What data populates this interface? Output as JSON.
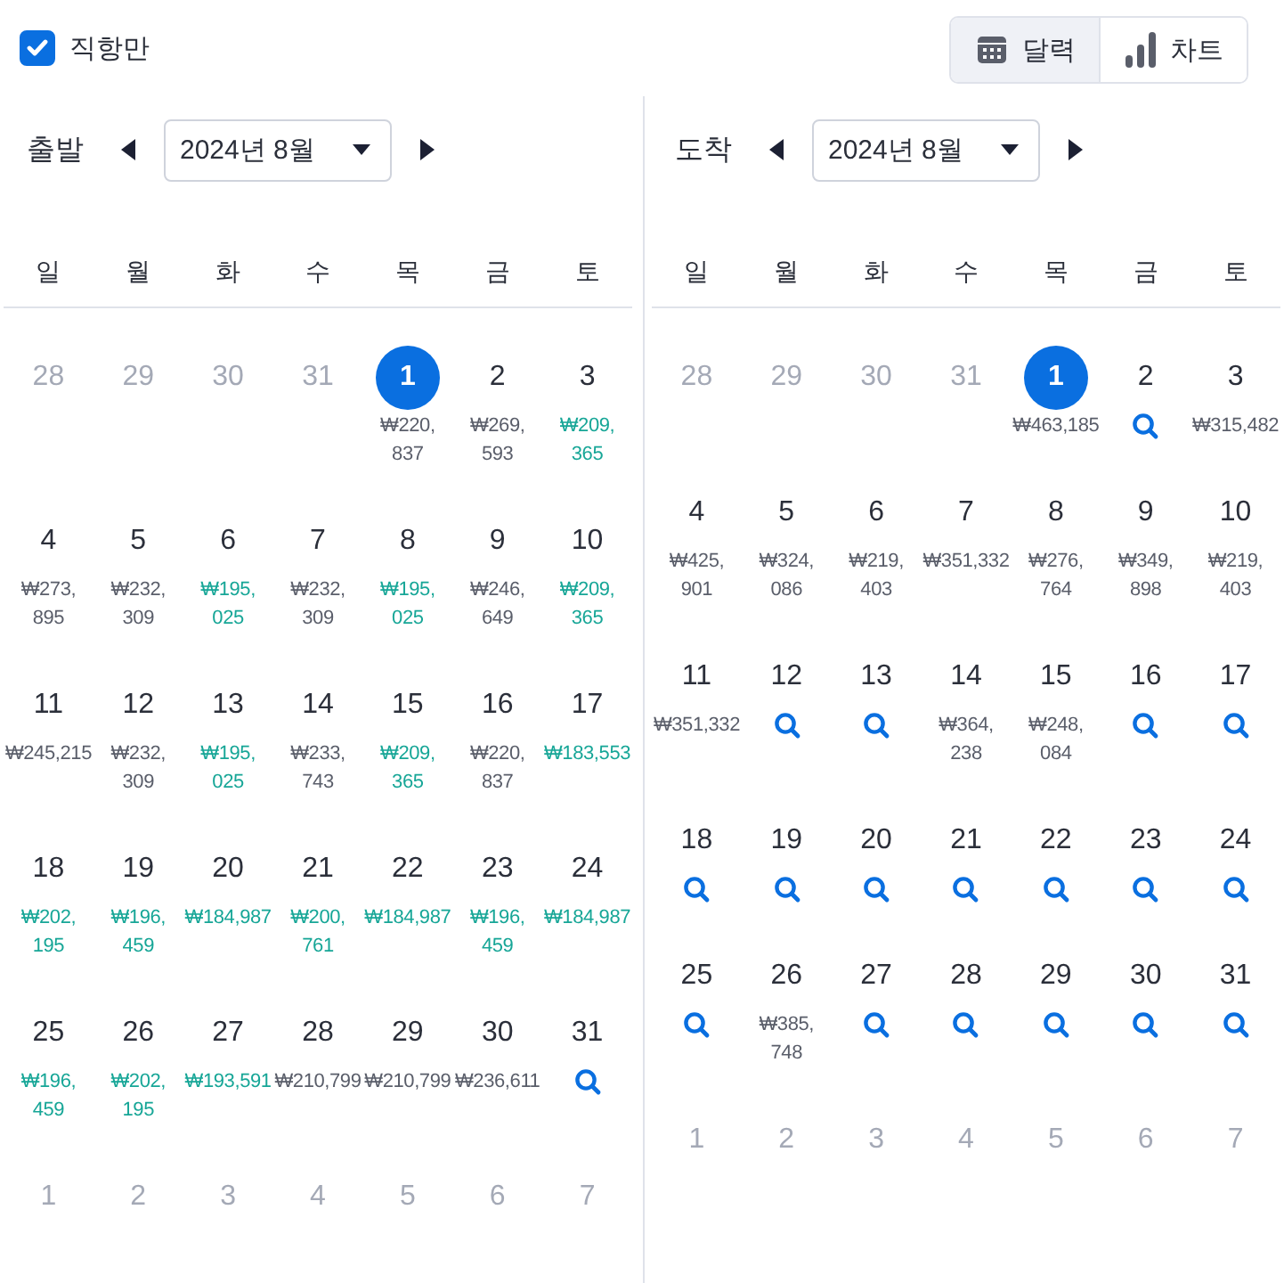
{
  "direct_only": {
    "label": "직항만",
    "checked": true
  },
  "view_toggle": [
    {
      "label": "달력",
      "kind": "calendar",
      "selected": true
    },
    {
      "label": "차트",
      "kind": "chart",
      "selected": false
    }
  ],
  "panels": [
    {
      "label": "출발",
      "month": "2024년 8월",
      "weekdays": [
        "일",
        "월",
        "화",
        "수",
        "목",
        "금",
        "토"
      ],
      "days": [
        {
          "day": "28",
          "kind": "outside",
          "selected": false
        },
        {
          "day": "29",
          "kind": "outside",
          "selected": false
        },
        {
          "day": "30",
          "kind": "outside",
          "selected": false
        },
        {
          "day": "31",
          "kind": "outside",
          "selected": false
        },
        {
          "day": "1",
          "kind": "price",
          "selected": true,
          "price": "₩220,\n837",
          "cheap": false
        },
        {
          "day": "2",
          "kind": "price",
          "selected": false,
          "price": "₩269,\n593",
          "cheap": false
        },
        {
          "day": "3",
          "kind": "price",
          "selected": false,
          "price": "₩209,\n365",
          "cheap": true
        },
        {
          "day": "4",
          "kind": "price",
          "selected": false,
          "price": "₩273,\n895",
          "cheap": false
        },
        {
          "day": "5",
          "kind": "price",
          "selected": false,
          "price": "₩232,\n309",
          "cheap": false
        },
        {
          "day": "6",
          "kind": "price",
          "selected": false,
          "price": "₩195,\n025",
          "cheap": true
        },
        {
          "day": "7",
          "kind": "price",
          "selected": false,
          "price": "₩232,\n309",
          "cheap": false
        },
        {
          "day": "8",
          "kind": "price",
          "selected": false,
          "price": "₩195,\n025",
          "cheap": true
        },
        {
          "day": "9",
          "kind": "price",
          "selected": false,
          "price": "₩246,\n649",
          "cheap": false
        },
        {
          "day": "10",
          "kind": "price",
          "selected": false,
          "price": "₩209,\n365",
          "cheap": true
        },
        {
          "day": "11",
          "kind": "price",
          "selected": false,
          "price": "₩245,215",
          "cheap": false
        },
        {
          "day": "12",
          "kind": "price",
          "selected": false,
          "price": "₩232,\n309",
          "cheap": false
        },
        {
          "day": "13",
          "kind": "price",
          "selected": false,
          "price": "₩195,\n025",
          "cheap": true
        },
        {
          "day": "14",
          "kind": "price",
          "selected": false,
          "price": "₩233,\n743",
          "cheap": false
        },
        {
          "day": "15",
          "kind": "price",
          "selected": false,
          "price": "₩209,\n365",
          "cheap": true
        },
        {
          "day": "16",
          "kind": "price",
          "selected": false,
          "price": "₩220,\n837",
          "cheap": false
        },
        {
          "day": "17",
          "kind": "price",
          "selected": false,
          "price": "₩183,553",
          "cheap": true
        },
        {
          "day": "18",
          "kind": "price",
          "selected": false,
          "price": "₩202,\n195",
          "cheap": true
        },
        {
          "day": "19",
          "kind": "price",
          "selected": false,
          "price": "₩196,\n459",
          "cheap": true
        },
        {
          "day": "20",
          "kind": "price",
          "selected": false,
          "price": "₩184,987",
          "cheap": true
        },
        {
          "day": "21",
          "kind": "price",
          "selected": false,
          "price": "₩200,\n761",
          "cheap": true
        },
        {
          "day": "22",
          "kind": "price",
          "selected": false,
          "price": "₩184,987",
          "cheap": true
        },
        {
          "day": "23",
          "kind": "price",
          "selected": false,
          "price": "₩196,\n459",
          "cheap": true
        },
        {
          "day": "24",
          "kind": "price",
          "selected": false,
          "price": "₩184,987",
          "cheap": true
        },
        {
          "day": "25",
          "kind": "price",
          "selected": false,
          "price": "₩196,\n459",
          "cheap": true
        },
        {
          "day": "26",
          "kind": "price",
          "selected": false,
          "price": "₩202,\n195",
          "cheap": true
        },
        {
          "day": "27",
          "kind": "price",
          "selected": false,
          "price": "₩193,591",
          "cheap": true
        },
        {
          "day": "28",
          "kind": "price",
          "selected": false,
          "price": "₩210,799",
          "cheap": false
        },
        {
          "day": "29",
          "kind": "price",
          "selected": false,
          "price": "₩210,799",
          "cheap": false
        },
        {
          "day": "30",
          "kind": "price",
          "selected": false,
          "price": "₩236,611",
          "cheap": false
        },
        {
          "day": "31",
          "kind": "search",
          "selected": false
        },
        {
          "day": "1",
          "kind": "outside",
          "selected": false
        },
        {
          "day": "2",
          "kind": "outside",
          "selected": false
        },
        {
          "day": "3",
          "kind": "outside",
          "selected": false
        },
        {
          "day": "4",
          "kind": "outside",
          "selected": false
        },
        {
          "day": "5",
          "kind": "outside",
          "selected": false
        },
        {
          "day": "6",
          "kind": "outside",
          "selected": false
        },
        {
          "day": "7",
          "kind": "outside",
          "selected": false
        }
      ]
    },
    {
      "label": "도착",
      "month": "2024년 8월",
      "weekdays": [
        "일",
        "월",
        "화",
        "수",
        "목",
        "금",
        "토"
      ],
      "days": [
        {
          "day": "28",
          "kind": "outside",
          "selected": false
        },
        {
          "day": "29",
          "kind": "outside",
          "selected": false
        },
        {
          "day": "30",
          "kind": "outside",
          "selected": false
        },
        {
          "day": "31",
          "kind": "outside",
          "selected": false
        },
        {
          "day": "1",
          "kind": "price",
          "selected": true,
          "price": "₩463,185",
          "cheap": false
        },
        {
          "day": "2",
          "kind": "search",
          "selected": false
        },
        {
          "day": "3",
          "kind": "price",
          "selected": false,
          "price": "₩315,482",
          "cheap": false
        },
        {
          "day": "4",
          "kind": "price",
          "selected": false,
          "price": "₩425,\n901",
          "cheap": false
        },
        {
          "day": "5",
          "kind": "price",
          "selected": false,
          "price": "₩324,\n086",
          "cheap": false
        },
        {
          "day": "6",
          "kind": "price",
          "selected": false,
          "price": "₩219,\n403",
          "cheap": false
        },
        {
          "day": "7",
          "kind": "price",
          "selected": false,
          "price": "₩351,332",
          "cheap": false
        },
        {
          "day": "8",
          "kind": "price",
          "selected": false,
          "price": "₩276,\n764",
          "cheap": false
        },
        {
          "day": "9",
          "kind": "price",
          "selected": false,
          "price": "₩349,\n898",
          "cheap": false
        },
        {
          "day": "10",
          "kind": "price",
          "selected": false,
          "price": "₩219,\n403",
          "cheap": false
        },
        {
          "day": "11",
          "kind": "price",
          "selected": false,
          "price": "₩351,332",
          "cheap": false
        },
        {
          "day": "12",
          "kind": "search",
          "selected": false
        },
        {
          "day": "13",
          "kind": "search",
          "selected": false
        },
        {
          "day": "14",
          "kind": "price",
          "selected": false,
          "price": "₩364,\n238",
          "cheap": false
        },
        {
          "day": "15",
          "kind": "price",
          "selected": false,
          "price": "₩248,\n084",
          "cheap": false
        },
        {
          "day": "16",
          "kind": "search",
          "selected": false
        },
        {
          "day": "17",
          "kind": "search",
          "selected": false
        },
        {
          "day": "18",
          "kind": "search",
          "selected": false
        },
        {
          "day": "19",
          "kind": "search",
          "selected": false
        },
        {
          "day": "20",
          "kind": "search",
          "selected": false
        },
        {
          "day": "21",
          "kind": "search",
          "selected": false
        },
        {
          "day": "22",
          "kind": "search",
          "selected": false
        },
        {
          "day": "23",
          "kind": "search",
          "selected": false
        },
        {
          "day": "24",
          "kind": "search",
          "selected": false
        },
        {
          "day": "25",
          "kind": "search",
          "selected": false
        },
        {
          "day": "26",
          "kind": "price",
          "selected": false,
          "price": "₩385,\n748",
          "cheap": false
        },
        {
          "day": "27",
          "kind": "search",
          "selected": false
        },
        {
          "day": "28",
          "kind": "search",
          "selected": false
        },
        {
          "day": "29",
          "kind": "search",
          "selected": false
        },
        {
          "day": "30",
          "kind": "search",
          "selected": false
        },
        {
          "day": "31",
          "kind": "search",
          "selected": false
        },
        {
          "day": "1",
          "kind": "outside",
          "selected": false
        },
        {
          "day": "2",
          "kind": "outside",
          "selected": false
        },
        {
          "day": "3",
          "kind": "outside",
          "selected": false
        },
        {
          "day": "4",
          "kind": "outside",
          "selected": false
        },
        {
          "day": "5",
          "kind": "outside",
          "selected": false
        },
        {
          "day": "6",
          "kind": "outside",
          "selected": false
        },
        {
          "day": "7",
          "kind": "outside",
          "selected": false
        }
      ]
    }
  ]
}
